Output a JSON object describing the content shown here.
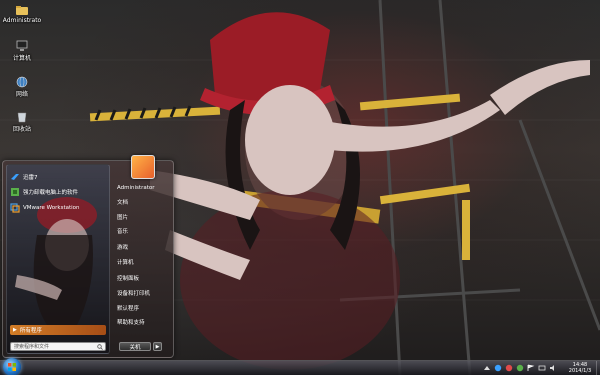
{
  "desktop_icons": [
    {
      "label": "Administrato",
      "icon": "folder-icon"
    },
    {
      "label": "计算机",
      "icon": "computer-icon"
    },
    {
      "label": "网络",
      "icon": "network-icon"
    },
    {
      "label": "回收站",
      "icon": "recycle-bin-icon"
    }
  ],
  "start_menu": {
    "pinned": [
      {
        "label": "迅雷7",
        "icon": "thunder-icon"
      },
      {
        "label": "强力卸载电脑上的软件",
        "icon": "uninstall-icon"
      },
      {
        "label": "VMware Workstation",
        "icon": "vmware-icon"
      }
    ],
    "all_programs_label": "所有程序",
    "search_placeholder": "搜索程序和文件",
    "user_name": "Administrator",
    "right_items": [
      "文档",
      "图片",
      "音乐",
      "游戏",
      "计算机",
      "控制面板",
      "设备和打印机",
      "默认程序",
      "帮助和支持"
    ],
    "shutdown_label": "关机",
    "shutdown_arrow": "▶"
  },
  "taskbar": {
    "time": "14:48",
    "date": "2014/1/3"
  },
  "colors": {
    "accent_orange": "#e07a26",
    "taskbar_dark": "#19191e",
    "orb_blue": "#1f6fc0"
  }
}
